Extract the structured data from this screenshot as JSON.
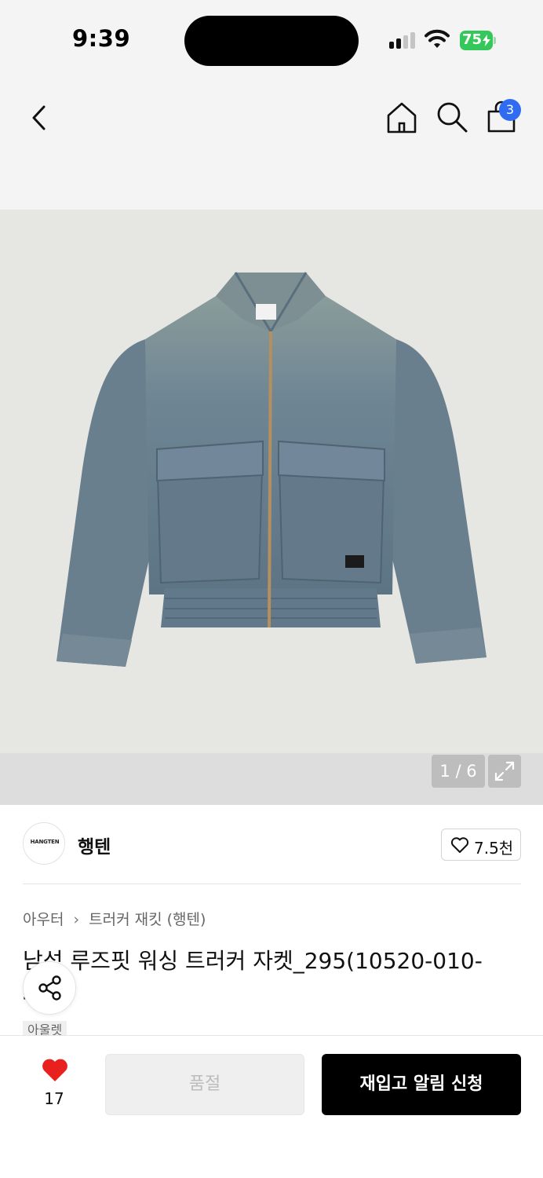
{
  "status_bar": {
    "time": "9:39",
    "battery": "75"
  },
  "nav": {
    "cart_count": "3"
  },
  "gallery": {
    "page_indicator": "1 / 6"
  },
  "brand": {
    "logo_text": "HANGTEN",
    "name": "행텐",
    "likes": "7.5천"
  },
  "product": {
    "breadcrumb": {
      "category": "아우터",
      "separator": "›",
      "subcategory": "트러커 재킷 (행텐)"
    },
    "title": "남성 루즈핏 워싱 트러커 자켓_295(10520-010-400)",
    "badge": "아울렛"
  },
  "bottom_bar": {
    "wish_count": "17",
    "soldout_label": "품절",
    "restock_label": "재입고 알림 신청"
  },
  "colors": {
    "accent_blue": "#2f6cf2",
    "heart_red": "#e8211f",
    "battery_green": "#34c759",
    "primary_black": "#000000"
  },
  "icons": [
    "back-icon",
    "home-icon",
    "search-icon",
    "shopping-bag-icon",
    "expand-icon",
    "heart-outline-icon",
    "share-icon",
    "heart-filled-icon"
  ]
}
